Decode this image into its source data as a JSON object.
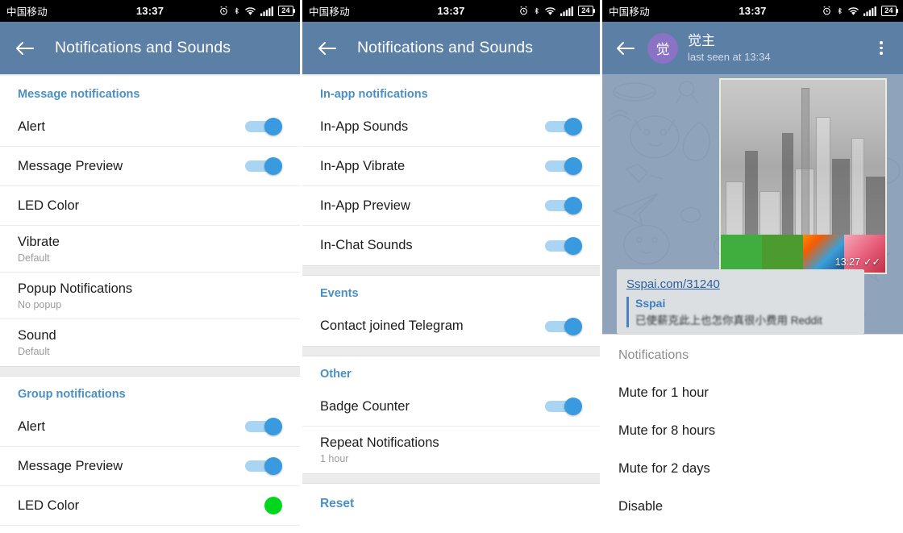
{
  "statusbar": {
    "carrier": "中国移动",
    "time": "13:37",
    "battery": "24",
    "icons": [
      "alarm-icon",
      "bluetooth-icon",
      "wifi-icon",
      "signal-icon",
      "battery-icon"
    ]
  },
  "panel1": {
    "toolbar": {
      "back": "←",
      "title": "Notifications and Sounds"
    },
    "sections": [
      {
        "header": "Message notifications",
        "rows": [
          {
            "title": "Alert",
            "sub": "",
            "control": "toggle-on"
          },
          {
            "title": "Message Preview",
            "sub": "",
            "control": "toggle-on"
          },
          {
            "title": "LED Color",
            "sub": "",
            "control": "none"
          },
          {
            "title": "Vibrate",
            "sub": "Default",
            "control": "none"
          },
          {
            "title": "Popup Notifications",
            "sub": "No popup",
            "control": "none"
          },
          {
            "title": "Sound",
            "sub": "Default",
            "control": "none"
          }
        ]
      },
      {
        "header": "Group notifications",
        "rows": [
          {
            "title": "Alert",
            "sub": "",
            "control": "toggle-on"
          },
          {
            "title": "Message Preview",
            "sub": "",
            "control": "toggle-on"
          },
          {
            "title": "LED Color",
            "sub": "",
            "control": "led-green"
          }
        ]
      }
    ]
  },
  "panel2": {
    "toolbar": {
      "back": "←",
      "title": "Notifications and Sounds"
    },
    "sections": [
      {
        "header": "In-app notifications",
        "rows": [
          {
            "title": "In-App Sounds",
            "sub": "",
            "control": "toggle-on"
          },
          {
            "title": "In-App Vibrate",
            "sub": "",
            "control": "toggle-on"
          },
          {
            "title": "In-App Preview",
            "sub": "",
            "control": "toggle-on"
          },
          {
            "title": "In-Chat Sounds",
            "sub": "",
            "control": "toggle-on"
          }
        ]
      },
      {
        "header": "Events",
        "rows": [
          {
            "title": "Contact joined Telegram",
            "sub": "",
            "control": "toggle-on"
          }
        ]
      },
      {
        "header": "Other",
        "rows": [
          {
            "title": "Badge Counter",
            "sub": "",
            "control": "toggle-on"
          },
          {
            "title": "Repeat Notifications",
            "sub": "1 hour",
            "control": "none"
          }
        ]
      }
    ],
    "reset_label": "Reset"
  },
  "panel3": {
    "toolbar": {
      "back": "←",
      "avatar_initial": "觉",
      "avatar_color": "#8a72c4",
      "title": "觉主",
      "subtitle": "last seen at 13:34",
      "more": "more-options-icon"
    },
    "message": {
      "time": "13:27",
      "status_ticks": "✓✓"
    },
    "link_preview": {
      "url": "Sspai.com/31240",
      "site": "Sspai",
      "description": "已使薪克此上也怎你真很小费用 Reddit"
    },
    "menu": {
      "header": "Notifications",
      "items": [
        "Mute for 1 hour",
        "Mute for 8 hours",
        "Mute for 2 days",
        "Disable"
      ]
    }
  },
  "colors": {
    "toolbar": "#5c7fa6",
    "accent_blue": "#4a90c4",
    "toggle_track": "#a9d4f2",
    "toggle_thumb": "#3a9ae0",
    "led_green": "#00d61e",
    "statusbar": "#000000"
  }
}
